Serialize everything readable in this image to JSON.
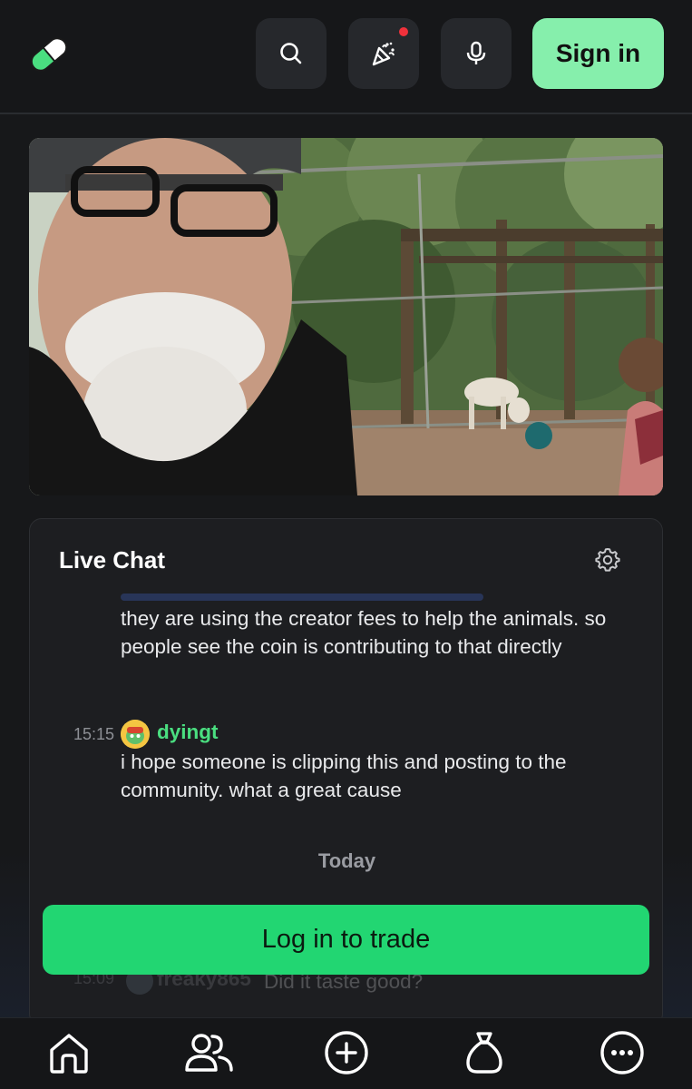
{
  "header": {
    "logo_icon": "pill-icon",
    "search_icon": "search-icon",
    "party_icon": "party-popper-icon",
    "mic_icon": "microphone-icon",
    "signin_label": "Sign in"
  },
  "colors": {
    "accent": "#86efac",
    "trade": "#22d672",
    "username": "#4ade80",
    "notification": "#f0313b"
  },
  "chat": {
    "title": "Live Chat",
    "settings_icon": "gear-icon",
    "messages": [
      {
        "time": "",
        "user": "",
        "text": "they are using the creator fees to help the animals. so people see the coin is contributing to that directly"
      },
      {
        "time": "15:15",
        "user": "dyingt",
        "text": "i hope someone is clipping this and posting to the community. what a great cause"
      }
    ],
    "day_divider": "Today",
    "partial_message": {
      "time": "15:09",
      "user": "freaky865",
      "text": "Did it taste good?"
    }
  },
  "trade_button": "Log in to trade",
  "bottom_nav": [
    "home-icon",
    "people-icon",
    "plus-circle-icon",
    "money-bag-icon",
    "more-icon"
  ]
}
